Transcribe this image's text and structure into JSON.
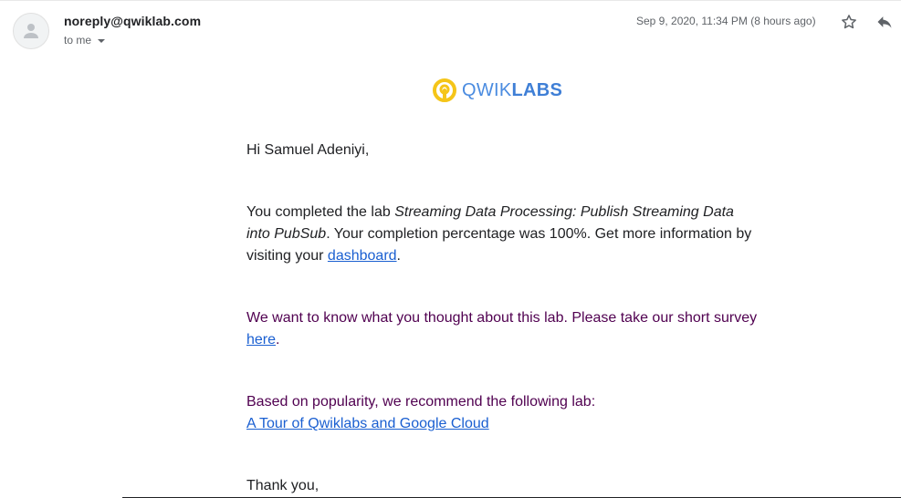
{
  "header": {
    "sender": "noreply@qwiklab.com",
    "recipient_label": "to me",
    "timestamp": "Sep 9, 2020, 11:34 PM (8 hours ago)"
  },
  "icons": {
    "avatar": "person-icon",
    "star": "star-outline-icon",
    "reply": "reply-icon",
    "recipient_menu": "chevron-down-icon",
    "logo": "qwiklabs-logo-icon"
  },
  "logo": {
    "light": "QWIK",
    "bold": "LABS"
  },
  "email": {
    "greeting": "Hi Samuel Adeniyi,",
    "completion_prefix": "You completed the lab ",
    "lab_name": "Streaming Data Processing: Publish Streaming Data into PubSub",
    "completion_suffix": ". Your completion percentage was 100%. Get more information by visiting your ",
    "dashboard_link": "dashboard",
    "completion_end": ".",
    "survey_prefix": "We want to know what you thought about this lab. Please take our short survey ",
    "survey_link": "here",
    "survey_end": ".",
    "recommend_text": "Based on popularity, we recommend the following lab:",
    "recommend_link": "A Tour of Qwiklabs and Google Cloud",
    "closing": "Thank you,"
  },
  "colors": {
    "link": "#1a5fd1",
    "quoted_text": "#500050",
    "logo_yellow": "#f5c518",
    "logo_blue": "#4a8be0"
  }
}
